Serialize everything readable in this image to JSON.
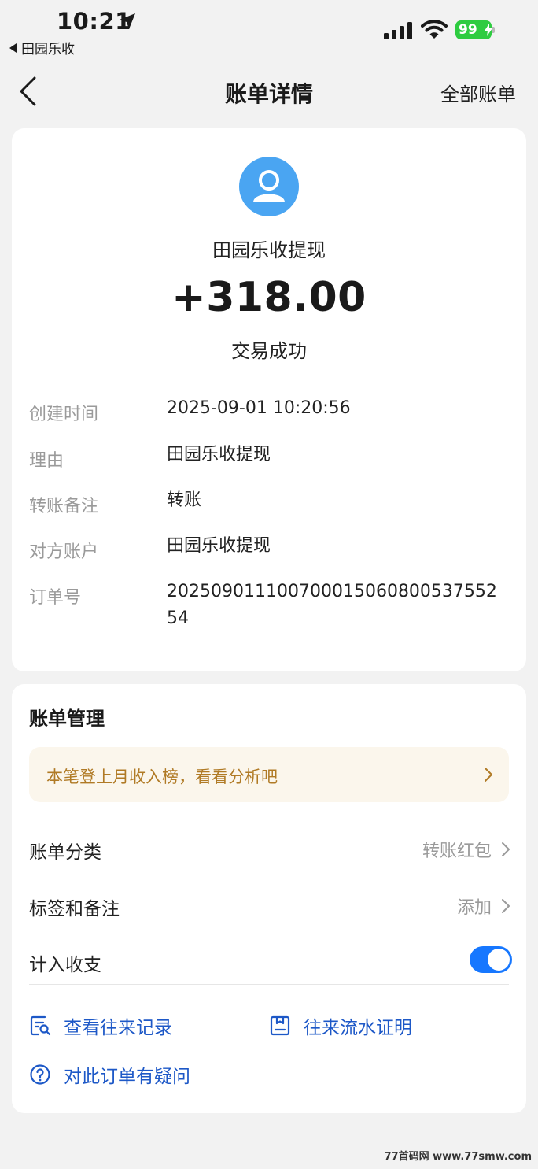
{
  "status_bar": {
    "time": "10:21",
    "back_app_label": "田园乐收",
    "battery_level": "99",
    "icons": [
      "location-arrow-icon",
      "signal-icon",
      "wifi-icon",
      "battery-icon"
    ]
  },
  "nav": {
    "title": "账单详情",
    "right_label": "全部账单",
    "back_icon": "chevron-left-icon"
  },
  "transaction": {
    "payee": "田园乐收提现",
    "amount": "+318.00",
    "status": "交易成功",
    "avatar_icon": "user-avatar-icon",
    "details": [
      {
        "label": "创建时间",
        "value": "2025-09-01 10:20:56"
      },
      {
        "label": "理由",
        "value": "田园乐收提现"
      },
      {
        "label": "转账备注",
        "value": "转账"
      },
      {
        "label": "对方账户",
        "value": "田园乐收提现"
      },
      {
        "label": "订单号",
        "value": "20250901110070001506080053755254"
      }
    ]
  },
  "management": {
    "title": "账单管理",
    "promo_text": "本笔登上月收入榜，看看分析吧",
    "rows": {
      "category": {
        "label": "账单分类",
        "value": "转账红包"
      },
      "tags": {
        "label": "标签和备注",
        "value": "添加"
      },
      "include": {
        "label": "计入收支",
        "enabled": true
      }
    },
    "actions": {
      "records": "查看往来记录",
      "proof": "往来流水证明",
      "question": "对此订单有疑问"
    }
  },
  "colors": {
    "accent": "#1677ff",
    "link": "#1d58c7",
    "promo_text": "#b07a25",
    "promo_bg": "#fbf6ec",
    "battery": "#2ecc40",
    "avatar": "#4aa5f2"
  },
  "watermark": "77首码网 www.77smw.com"
}
